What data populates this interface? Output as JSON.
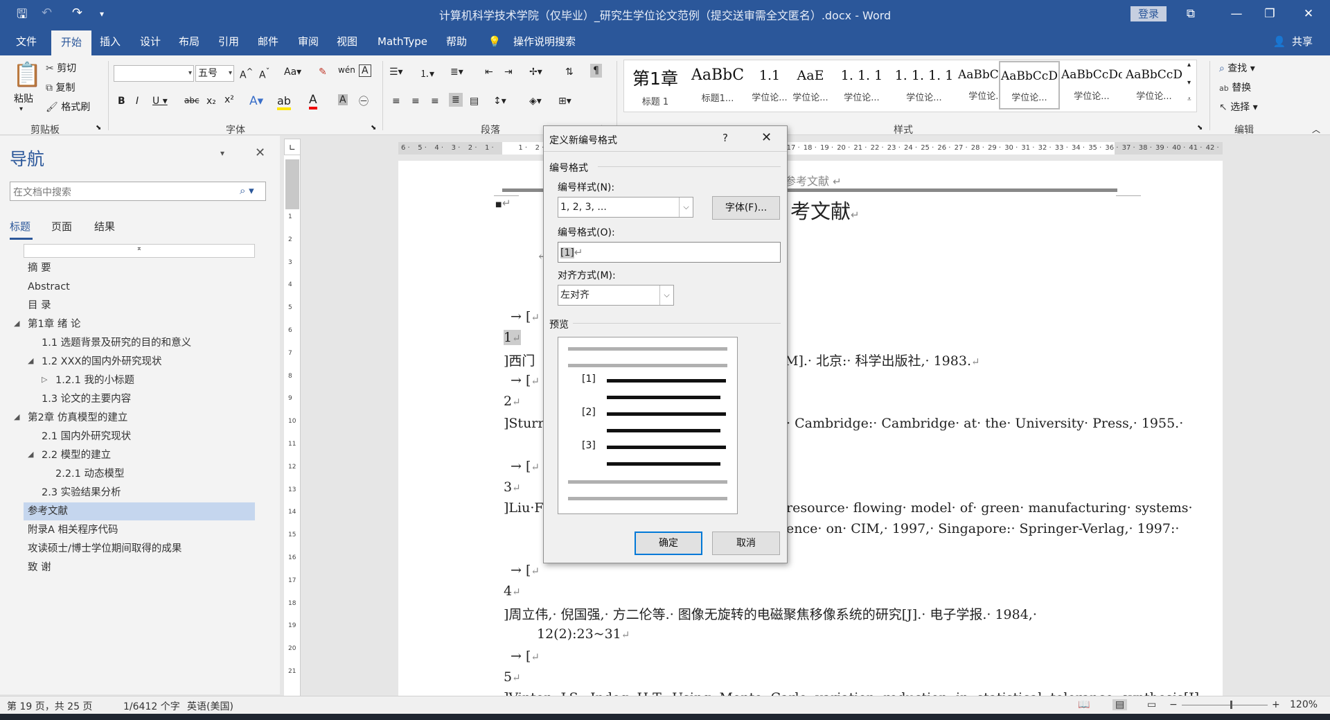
{
  "titlebar": {
    "title": "计算机科学技术学院（仅毕业）_研究生学位论文范例（提交送审需全文匿名）.docx - Word",
    "login": "登录"
  },
  "tabs": [
    "文件",
    "开始",
    "插入",
    "设计",
    "布局",
    "引用",
    "邮件",
    "审阅",
    "视图",
    "MathType",
    "帮助"
  ],
  "tell_me": "操作说明搜索",
  "share": "共享",
  "ribbon": {
    "paste": "粘贴",
    "cut": "剪切",
    "copy": "复制",
    "format_painter": "格式刷",
    "clipboard_group": "剪贴板",
    "font_name": "",
    "font_size": "五号",
    "font_group": "字体",
    "paragraph_group": "段落",
    "styles_group": "样式",
    "editing_group": "编辑",
    "find": "查找",
    "replace": "替换",
    "select": "选择",
    "styles": [
      {
        "preview": "第1章",
        "name": "标题 1"
      },
      {
        "preview": "AaBbC",
        "name": "标题1..."
      },
      {
        "preview": "1.1",
        "name": "学位论..."
      },
      {
        "preview": "AaE",
        "name": "学位论..."
      },
      {
        "preview": "1. 1. 1",
        "name": "学位论..."
      },
      {
        "preview": "1. 1. 1. 1",
        "name": "学位论..."
      },
      {
        "preview": "AaBbCcD",
        "name": "学位论..."
      },
      {
        "preview": "AaBbCcD",
        "name": "学位论..."
      },
      {
        "preview": "AaBbCcDc",
        "name": "学位论..."
      },
      {
        "preview": "AaBbCcD",
        "name": "学位论..."
      }
    ]
  },
  "nav": {
    "title": "导航",
    "search_placeholder": "在文档中搜索",
    "tabs": [
      "标题",
      "页面",
      "结果"
    ],
    "items": [
      "摘 要",
      "Abstract",
      "目 录",
      "第1章 绪 论",
      "1.1 选题背景及研究的目的和意义",
      "1.2 XXX的国内外研究现状",
      "1.2.1 我的小标题",
      "1.3 论文的主要内容",
      "第2章 仿真模型的建立",
      "2.1 国内外研究现状",
      "2.2 模型的建立",
      "2.2.1 动态模型",
      "2.3 实验结果分析",
      "参考文献",
      "附录A 相关程序代码",
      "攻读硕士/博士学位期间取得的成果",
      "致 谢"
    ]
  },
  "document": {
    "header_text": "参考文献",
    "heading_tail": "考文献",
    "lines": [
      "1",
      "]西门",
      "M].· 北京:· 科学出版社,· 1983.",
      "2",
      "]Sturro",
      "· Cambridge:· Cambridge· at· the· University· Press,· 1955.·",
      "3",
      "]Liu·Fe",
      "resource· flowing· model· of· green· manufacturing· systems·",
      "ence· on· CIM,· 1997,· Singapore:· Springer-Verlag,· 1997:·",
      "4",
      "]周立伟,· 倪国强,· 方二伦等.· 图像无旋转的电磁聚焦移像系统的研究[J].· 电子学报.· 1984,·",
      "12(2):23~31",
      "5",
      "]Vinton· J.S.· Indeg· H.T.· Using· Monte· Carlo· variation· reduction· in· statistical· tolerance· synthesis[J]."
    ],
    "bracket": "→ ["
  },
  "dialog": {
    "title": "定义新编号格式",
    "help": "?",
    "section_format": "编号格式",
    "style_label": "编号样式(N):",
    "style_value": "1, 2, 3, ...",
    "font_button": "字体(F)...",
    "format_label": "编号格式(O):",
    "format_value": "[1]",
    "align_label": "对齐方式(M):",
    "align_value": "左对齐",
    "preview_label": "预览",
    "preview_numbers": [
      "[1]",
      "[2]",
      "[3]"
    ],
    "ok": "确定",
    "cancel": "取消"
  },
  "status": {
    "page": "第 19 页，共 25 页",
    "words": "1/6412 个字",
    "language": "英语(美国)",
    "zoom": "120%"
  }
}
